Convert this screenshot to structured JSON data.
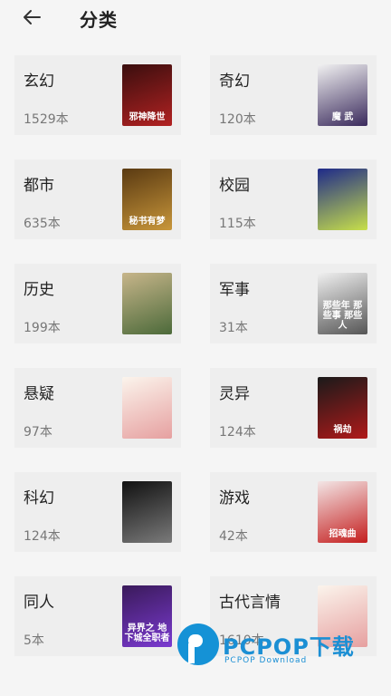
{
  "header": {
    "title": "分类",
    "back_icon": "arrow-left-icon"
  },
  "categories": [
    {
      "name": "玄幻",
      "count": "1529本",
      "cover": {
        "colors": [
          "#3a0e0e",
          "#b22222"
        ],
        "text": "邪神降世"
      }
    },
    {
      "name": "奇幻",
      "count": "120本",
      "cover": {
        "colors": [
          "#f2f2f2",
          "#3a2a5c"
        ],
        "text": "魔 武"
      }
    },
    {
      "name": "都市",
      "count": "635本",
      "cover": {
        "colors": [
          "#5a3a12",
          "#c8963a"
        ],
        "text": "秘书有梦"
      }
    },
    {
      "name": "校园",
      "count": "115本",
      "cover": {
        "colors": [
          "#1e2a8a",
          "#c8e04a"
        ],
        "text": ""
      }
    },
    {
      "name": "历史",
      "count": "199本",
      "cover": {
        "colors": [
          "#c7b58a",
          "#4c6a3a"
        ],
        "text": ""
      }
    },
    {
      "name": "军事",
      "count": "31本",
      "cover": {
        "colors": [
          "#f0f0f0",
          "#555555"
        ],
        "text": "那些年 那些事 那些人"
      }
    },
    {
      "name": "悬疑",
      "count": "97本",
      "cover": {
        "colors": [
          "#fbf4ec",
          "#e6a0a0"
        ],
        "text": ""
      }
    },
    {
      "name": "灵异",
      "count": "124本",
      "cover": {
        "colors": [
          "#1a1a1a",
          "#b01a1a"
        ],
        "text": "祸劫"
      }
    },
    {
      "name": "科幻",
      "count": "124本",
      "cover": {
        "colors": [
          "#111111",
          "#7a7a7a"
        ],
        "text": ""
      }
    },
    {
      "name": "游戏",
      "count": "42本",
      "cover": {
        "colors": [
          "#f3e6e6",
          "#c41e1e"
        ],
        "text": "招魂曲"
      }
    },
    {
      "name": "同人",
      "count": "5本",
      "cover": {
        "colors": [
          "#3a1a5a",
          "#7a3ad0"
        ],
        "text": "异界之 地下城全职者"
      }
    },
    {
      "name": "古代言情",
      "count": "1610本",
      "cover": {
        "colors": [
          "#fbf4ec",
          "#e6a0a0"
        ],
        "text": ""
      }
    }
  ],
  "watermark": {
    "brand": "PCPOP下载",
    "sub": "PCPOP Download",
    "color": "#1b8fd4"
  }
}
